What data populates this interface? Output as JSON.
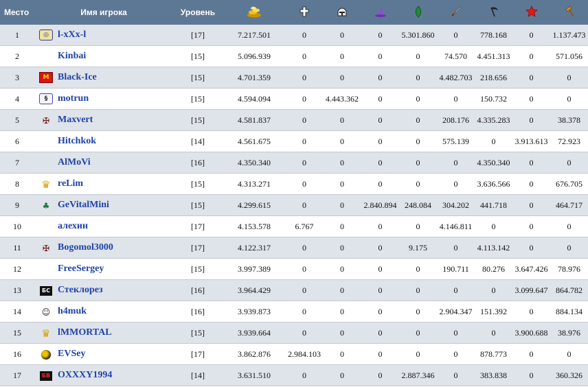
{
  "headers": {
    "place": "Место",
    "name": "Имя игрока",
    "level": "Уровень",
    "icons": [
      "gold-icon",
      "cross-icon",
      "helmet-icon",
      "wizard-hat-icon",
      "leaf-icon",
      "sword-icon",
      "scythe-icon",
      "red-star-icon",
      "hammer-icon"
    ]
  },
  "colors": {
    "header": "#5d7894",
    "row_alt": "#dfe3ea",
    "name": "#1f43a8"
  },
  "rows": [
    {
      "place": "1",
      "clan": "swirl",
      "clan_text": "◎",
      "name": "l-xXx-l",
      "level": "[17]",
      "total": "7.217.501",
      "v": [
        "0",
        "0",
        "0",
        "5.301.860",
        "0",
        "778.168",
        "0",
        "1.137.473"
      ]
    },
    {
      "place": "2",
      "clan": "none",
      "clan_text": "",
      "name": "Kinbai",
      "level": "[15]",
      "total": "5.096.939",
      "v": [
        "0",
        "0",
        "0",
        "0",
        "74.570",
        "4.451.313",
        "0",
        "571.056"
      ]
    },
    {
      "place": "3",
      "clan": "red-box",
      "clan_text": "M",
      "name": "Black-Ice",
      "level": "[15]",
      "total": "4.701.359",
      "v": [
        "0",
        "0",
        "0",
        "0",
        "4.482.703",
        "218.656",
        "0",
        "0"
      ]
    },
    {
      "place": "4",
      "clan": "snake",
      "clan_text": "§",
      "name": "motrun",
      "level": "[15]",
      "total": "4.594.094",
      "v": [
        "0",
        "4.443.362",
        "0",
        "0",
        "0",
        "150.732",
        "0",
        "0"
      ]
    },
    {
      "place": "5",
      "clan": "bat",
      "clan_text": "✠",
      "name": "Maxvert",
      "level": "[15]",
      "total": "4.581.837",
      "v": [
        "0",
        "0",
        "0",
        "0",
        "208.176",
        "4.335.283",
        "0",
        "38.378"
      ]
    },
    {
      "place": "6",
      "clan": "none",
      "clan_text": "",
      "name": "Hitchkok",
      "level": "[14]",
      "total": "4.561.675",
      "v": [
        "0",
        "0",
        "0",
        "0",
        "575.139",
        "0",
        "3.913.613",
        "72.923"
      ]
    },
    {
      "place": "7",
      "clan": "none",
      "clan_text": "",
      "name": "AlMoVi",
      "level": "[16]",
      "total": "4.350.340",
      "v": [
        "0",
        "0",
        "0",
        "0",
        "0",
        "4.350.340",
        "0",
        "0"
      ]
    },
    {
      "place": "8",
      "clan": "crown",
      "clan_text": "♛",
      "name": "reLim",
      "level": "[15]",
      "total": "4.313.271",
      "v": [
        "0",
        "0",
        "0",
        "0",
        "0",
        "3.636.566",
        "0",
        "676.705"
      ]
    },
    {
      "place": "9",
      "clan": "tree",
      "clan_text": "♣",
      "name": "GeVitalMini",
      "level": "[15]",
      "total": "4.299.615",
      "v": [
        "0",
        "0",
        "2.840.894",
        "248.084",
        "304.202",
        "441.718",
        "0",
        "464.717"
      ]
    },
    {
      "place": "10",
      "clan": "none",
      "clan_text": "",
      "name": "алехин",
      "level": "[17]",
      "total": "4.153.578",
      "v": [
        "6.767",
        "0",
        "0",
        "0",
        "4.146.811",
        "0",
        "0",
        "0"
      ]
    },
    {
      "place": "11",
      "clan": "bat",
      "clan_text": "✠",
      "name": "Bogomol3000",
      "level": "[17]",
      "total": "4.122.317",
      "v": [
        "0",
        "0",
        "0",
        "9.175",
        "0",
        "4.113.142",
        "0",
        "0"
      ]
    },
    {
      "place": "12",
      "clan": "none",
      "clan_text": "",
      "name": "FreeSergey",
      "level": "[15]",
      "total": "3.997.389",
      "v": [
        "0",
        "0",
        "0",
        "0",
        "190.711",
        "80.276",
        "3.647.426",
        "78.976"
      ]
    },
    {
      "place": "13",
      "clan": "bs",
      "clan_text": "БС",
      "name": "Стеклорез",
      "level": "[16]",
      "total": "3.964.429",
      "v": [
        "0",
        "0",
        "0",
        "0",
        "0",
        "0",
        "3.099.647",
        "864.782"
      ]
    },
    {
      "place": "14",
      "clan": "face",
      "clan_text": "☺",
      "name": "h4muk",
      "level": "[16]",
      "total": "3.939.873",
      "v": [
        "0",
        "0",
        "0",
        "0",
        "2.904.347",
        "151.392",
        "0",
        "884.134"
      ]
    },
    {
      "place": "15",
      "clan": "crown",
      "clan_text": "♛",
      "name": "lMMORTAL",
      "level": "[15]",
      "total": "3.939.664",
      "v": [
        "0",
        "0",
        "0",
        "0",
        "0",
        "0",
        "3.900.688",
        "38.976"
      ]
    },
    {
      "place": "16",
      "clan": "ball",
      "clan_text": "",
      "name": "EVSey",
      "level": "[17]",
      "total": "3.862.876",
      "v": [
        "2.984.103",
        "0",
        "0",
        "0",
        "0",
        "878.773",
        "0",
        "0"
      ]
    },
    {
      "place": "17",
      "clan": "bw",
      "clan_text": "БВ",
      "name": "OXXXY1994",
      "level": "[14]",
      "total": "3.631.510",
      "v": [
        "0",
        "0",
        "0",
        "2.887.346",
        "0",
        "383.838",
        "0",
        "360.326"
      ]
    }
  ]
}
